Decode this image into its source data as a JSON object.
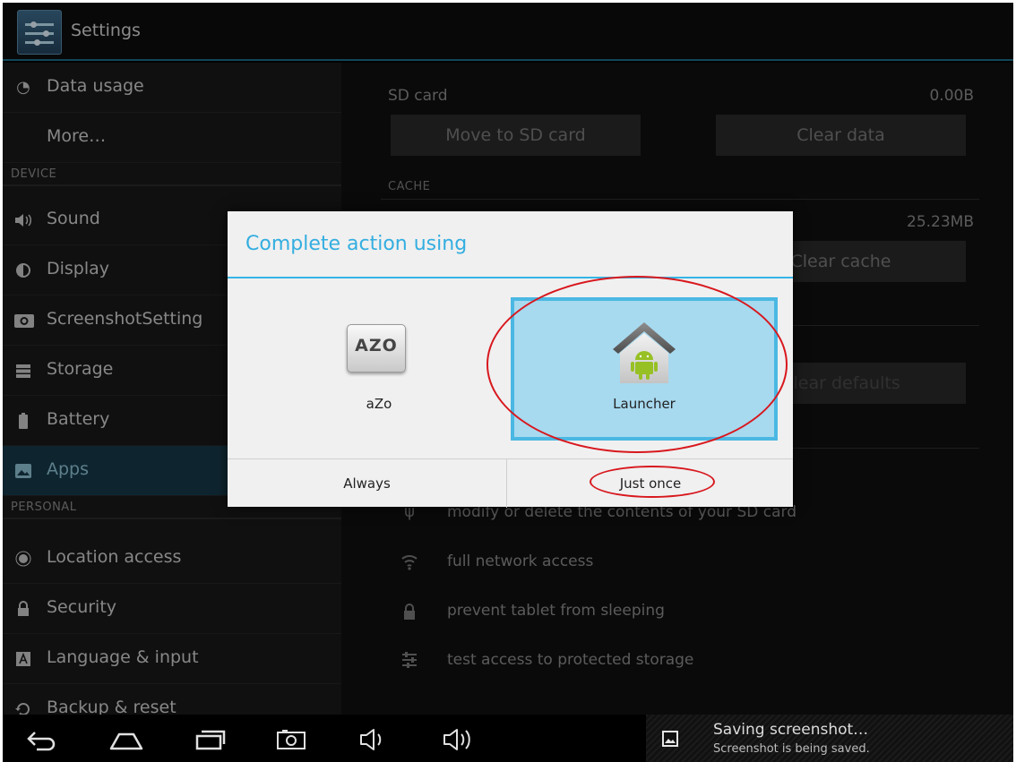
{
  "app": {
    "title": "Settings"
  },
  "sidebar": {
    "items": [
      {
        "label": "Data usage",
        "icon": "data-usage-icon"
      },
      {
        "label": "More…",
        "icon": ""
      },
      {
        "section": "DEVICE"
      },
      {
        "label": "Sound",
        "icon": "speaker-icon"
      },
      {
        "label": "Display",
        "icon": "brightness-icon"
      },
      {
        "label": "ScreenshotSetting",
        "icon": "camera-icon"
      },
      {
        "label": "Storage",
        "icon": "storage-icon"
      },
      {
        "label": "Battery",
        "icon": "battery-icon"
      },
      {
        "label": "Apps",
        "icon": "apps-icon",
        "selected": true
      },
      {
        "section": "PERSONAL"
      },
      {
        "label": "Location access",
        "icon": "location-icon"
      },
      {
        "label": "Security",
        "icon": "lock-icon"
      },
      {
        "label": "Language & input",
        "icon": "keyboard-icon"
      },
      {
        "label": "Backup & reset",
        "icon": "backup-icon"
      }
    ]
  },
  "main": {
    "sd_card_label": "SD card",
    "sd_card_value": "0.00B",
    "move_button": "Move to SD card",
    "clear_data_button": "Clear data",
    "cache_header": "CACHE",
    "cache_value": "25.23MB",
    "clear_cache_button": "Clear cache",
    "clear_defaults_button": "Clear defaults",
    "permissions": [
      {
        "text": "modify or delete the contents of your SD card",
        "icon": "usb-icon"
      },
      {
        "text": "full network access",
        "icon": "wifi-icon"
      },
      {
        "text": "prevent tablet from sleeping",
        "icon": "lock-icon"
      },
      {
        "text": "test access to protected storage",
        "icon": "sliders-icon"
      }
    ]
  },
  "dialog": {
    "title": "Complete action using",
    "choices": [
      {
        "label": "aZo",
        "icon_text": "AZO"
      },
      {
        "label": "Launcher",
        "selected": true
      }
    ],
    "always_button": "Always",
    "once_button": "Just once"
  },
  "notification": {
    "title": "Saving screenshot…",
    "subtitle": "Screenshot is being saved."
  },
  "colors": {
    "accent": "#33b5e5",
    "selection": "#a7d9ef",
    "annotation": "#d8181e"
  }
}
